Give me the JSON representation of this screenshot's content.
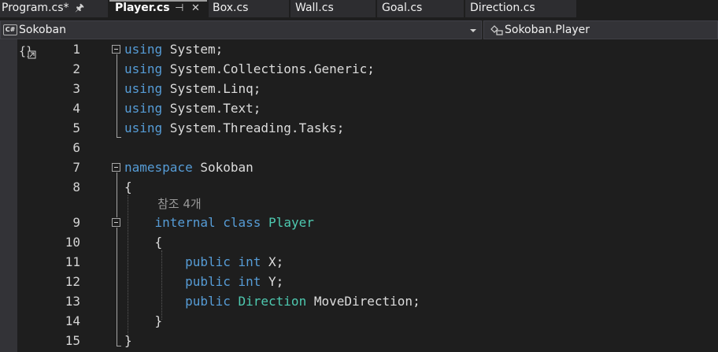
{
  "tabs": [
    {
      "label": "Program.cs*",
      "pin": "pin-icon"
    },
    {
      "label": "Player.cs",
      "pin": "pin-icon",
      "close": "close-icon",
      "active": true
    },
    {
      "label": "Box.cs"
    },
    {
      "label": "Wall.cs"
    },
    {
      "label": "Goal.cs"
    },
    {
      "label": "Direction.cs"
    }
  ],
  "navbar": {
    "project_badge": "C#",
    "project": "Sokoban",
    "member": "Sokoban.Player"
  },
  "editor": {
    "line_numbers": [
      "1",
      "2",
      "3",
      "4",
      "5",
      "6",
      "7",
      "8",
      "9",
      "10",
      "11",
      "12",
      "13",
      "14",
      "15"
    ],
    "codelens": "참조 4개",
    "lines": [
      [
        {
          "t": "using",
          "c": "kw"
        },
        {
          "t": " System;",
          "c": "tx"
        }
      ],
      [
        {
          "t": "using",
          "c": "kw"
        },
        {
          "t": " System.Collections.Generic;",
          "c": "tx"
        }
      ],
      [
        {
          "t": "using",
          "c": "kw"
        },
        {
          "t": " System.Linq;",
          "c": "tx"
        }
      ],
      [
        {
          "t": "using",
          "c": "kw"
        },
        {
          "t": " System.Text;",
          "c": "tx"
        }
      ],
      [
        {
          "t": "using",
          "c": "kw"
        },
        {
          "t": " System.Threading.Tasks;",
          "c": "tx"
        }
      ],
      [],
      [
        {
          "t": "namespace",
          "c": "kw"
        },
        {
          "t": " Sokoban",
          "c": "tx"
        }
      ],
      [
        {
          "t": "{",
          "c": "tx"
        }
      ],
      [
        {
          "t": "    ",
          "c": "tx"
        },
        {
          "t": "internal",
          "c": "kw"
        },
        {
          "t": " ",
          "c": "tx"
        },
        {
          "t": "class",
          "c": "kw"
        },
        {
          "t": " ",
          "c": "tx"
        },
        {
          "t": "Player",
          "c": "ty"
        }
      ],
      [
        {
          "t": "    {",
          "c": "tx"
        }
      ],
      [
        {
          "t": "        ",
          "c": "tx"
        },
        {
          "t": "public",
          "c": "kw"
        },
        {
          "t": " ",
          "c": "tx"
        },
        {
          "t": "int",
          "c": "kw"
        },
        {
          "t": " X;",
          "c": "tx"
        }
      ],
      [
        {
          "t": "        ",
          "c": "tx"
        },
        {
          "t": "public",
          "c": "kw"
        },
        {
          "t": " ",
          "c": "tx"
        },
        {
          "t": "int",
          "c": "kw"
        },
        {
          "t": " Y;",
          "c": "tx"
        }
      ],
      [
        {
          "t": "        ",
          "c": "tx"
        },
        {
          "t": "public",
          "c": "kw"
        },
        {
          "t": " ",
          "c": "tx"
        },
        {
          "t": "Direction",
          "c": "ty"
        },
        {
          "t": " MoveDirection;",
          "c": "tx"
        }
      ],
      [
        {
          "t": "    }",
          "c": "tx"
        }
      ],
      [
        {
          "t": "}",
          "c": "tx"
        }
      ]
    ]
  },
  "colors": {
    "keyword": "#569cd6",
    "type": "#4ec9b0",
    "text": "#dcdcdc",
    "background": "#1e1e1e"
  }
}
